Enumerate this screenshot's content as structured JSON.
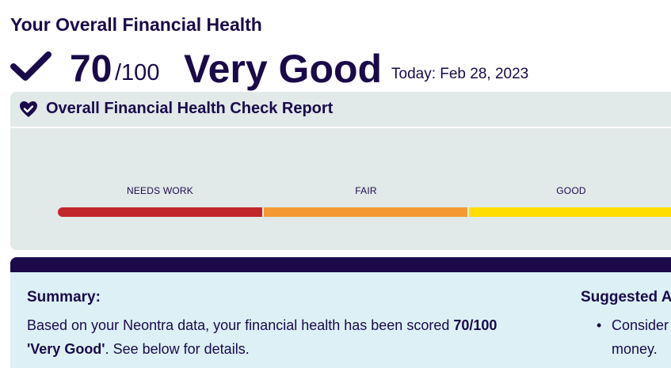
{
  "page": {
    "title": "Your Overall Financial Health"
  },
  "score": {
    "value": "70",
    "max": "/100",
    "rating": "Very Good",
    "date": "Today: Feb 28, 2023",
    "check_icon": "check-icon"
  },
  "report": {
    "title": "Overall Financial Health Check Report",
    "icon": "heart-check-icon",
    "scale": [
      {
        "label": "NEEDS WORK",
        "color": "#c1262c"
      },
      {
        "label": "FAIR",
        "color": "#f59a33"
      },
      {
        "label": "GOOD",
        "color": "#ffdd00"
      }
    ]
  },
  "summary": {
    "heading": "Summary:",
    "text_prefix": "Based on your Neontra data, your financial health has been scored ",
    "score_bold": "70/100",
    "rating_bold": "'Very Good'",
    "text_suffix": ". See below for details."
  },
  "suggested": {
    "heading": "Suggested A",
    "item_line1": "Consider",
    "item_line2": "money."
  },
  "colors": {
    "navy": "#1a0a4a",
    "report_bg": "#e1e9e9",
    "summary_bg": "#dcf0f6"
  }
}
